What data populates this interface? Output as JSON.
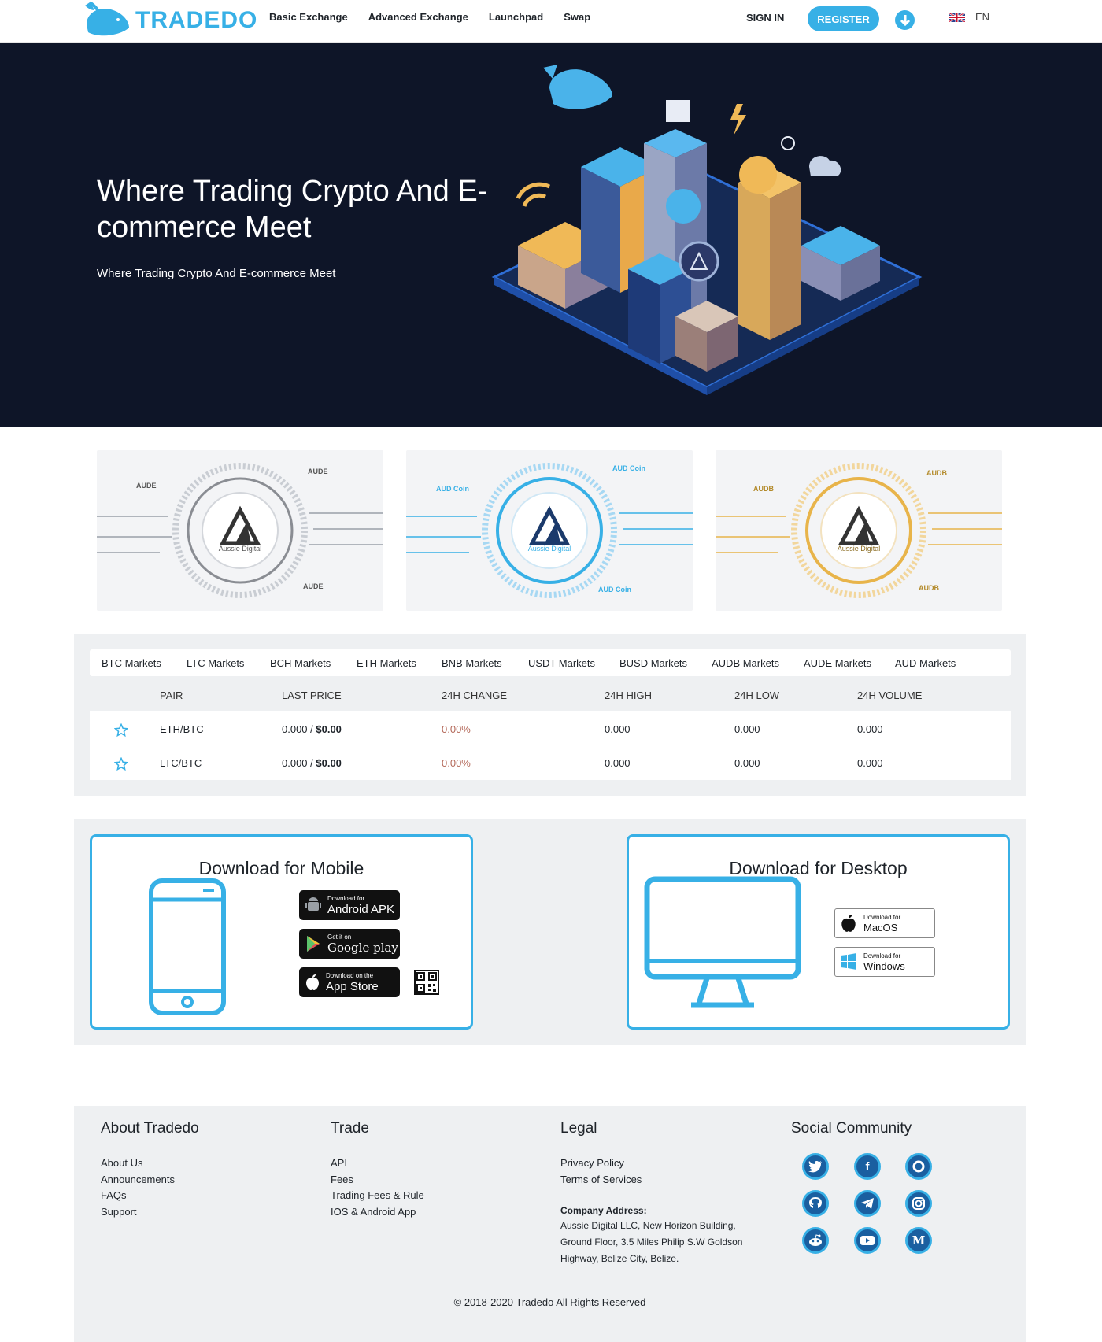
{
  "nav": {
    "logo_text": "TRADEDO",
    "links": [
      "Basic Exchange",
      "Advanced Exchange",
      "Launchpad",
      "Swap"
    ],
    "signin": "SIGN IN",
    "register": "REGISTER",
    "language": "EN"
  },
  "hero": {
    "title": "Where Trading Crypto And E-commerce Meet",
    "subtitle": "Where Trading Crypto And E-commerce Meet"
  },
  "banners": [
    {
      "coin": "AUDE",
      "brand": "Aussie Digital",
      "color": "#8a8d93"
    },
    {
      "coin": "AUD Coin",
      "brand": "Aussie Digital",
      "color": "#37b0e6"
    },
    {
      "coin": "AUDB",
      "brand": "Aussie Digital",
      "color": "#e8b44a"
    }
  ],
  "markets": {
    "tabs": [
      "BTC Markets",
      "LTC Markets",
      "BCH Markets",
      "ETH Markets",
      "BNB Markets",
      "USDT Markets",
      "BUSD Markets",
      "AUDB Markets",
      "AUDE Markets",
      "AUD Markets"
    ],
    "columns": [
      "PAIR",
      "LAST PRICE",
      "24H CHANGE",
      "24H HIGH",
      "24H LOW",
      "24H VOLUME"
    ],
    "rows": [
      {
        "pair": "ETH/BTC",
        "last_price": "0.000 / ",
        "last_price_usd": "$0.00",
        "change": "0.00%",
        "high": "0.000",
        "low": "0.000",
        "volume": "0.000"
      },
      {
        "pair": "LTC/BTC",
        "last_price": "0.000 / ",
        "last_price_usd": "$0.00",
        "change": "0.00%",
        "high": "0.000",
        "low": "0.000",
        "volume": "0.000"
      }
    ]
  },
  "download": {
    "mobile_title": "Download for Mobile",
    "desktop_title": "Download for Desktop",
    "android": {
      "small": "Download for",
      "big": "Android APK"
    },
    "google": {
      "small": "Get it on",
      "big": "Google play"
    },
    "appstore": {
      "small": "Download on the",
      "big": "App Store"
    },
    "macos": {
      "small": "Download for",
      "big": "MacOS"
    },
    "windows": {
      "small": "Download for",
      "big": "Windows"
    }
  },
  "footer": {
    "about_title": "About Tradedo",
    "about_links": [
      "About Us",
      "Announcements",
      "FAQs",
      "Support"
    ],
    "trade_title": "Trade",
    "trade_links": [
      "API",
      "Fees",
      "Trading Fees & Rule",
      "IOS & Android App"
    ],
    "legal_title": "Legal",
    "legal_links": [
      "Privacy Policy",
      "Terms of Services"
    ],
    "address_title": "Company Address:",
    "address": "Aussie Digital LLC, New Horizon Building, Ground Floor, 3.5 Miles Philip S.W Goldson Highway, Belize City, Belize.",
    "social_title": "Social Community",
    "social_icons": [
      "twitter-icon",
      "facebook-icon",
      "bitcointalk-icon",
      "github-icon",
      "telegram-icon",
      "instagram-icon",
      "reddit-icon",
      "youtube-icon",
      "medium-icon"
    ],
    "copyright": "© 2018-2020 Tradedo All Rights Reserved"
  }
}
